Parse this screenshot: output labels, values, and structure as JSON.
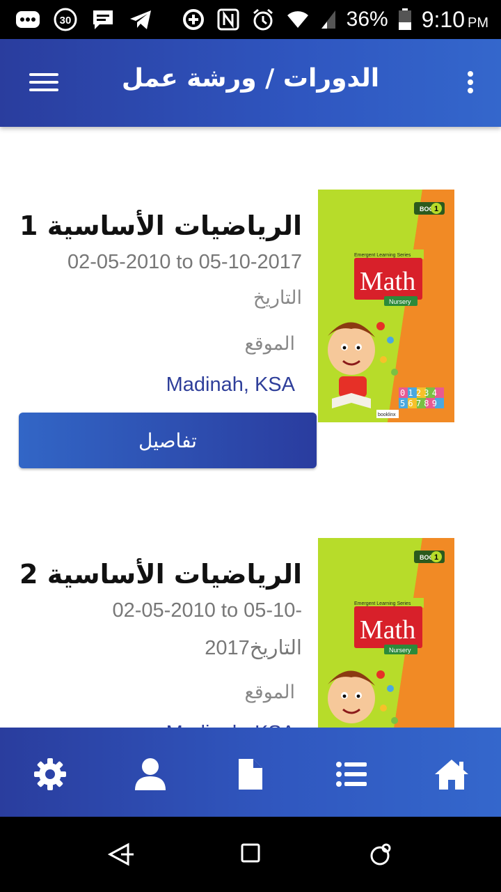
{
  "status_bar": {
    "notification_count": "30",
    "battery": "36%",
    "time": "9:10",
    "ampm": "PM"
  },
  "app_bar": {
    "title": "الدورات / ورشة عمل"
  },
  "courses": [
    {
      "title": "الرياضيات الأساسية 1",
      "dates": "02-05-2010 to 05-10-2017",
      "date_label": "التاريخ",
      "location_label": "الموقع",
      "location": "Madinah, KSA",
      "details_label": "تفاصيل",
      "cover": {
        "book_label": "BOOK",
        "book_number": "1",
        "series": "Emergent Learning Series",
        "subject": "Math",
        "level": "Nursery",
        "digits_top": "01234",
        "digits_bottom": "56789",
        "publisher": "booklinx"
      }
    },
    {
      "title": "الرياضيات الأساسية 2",
      "dates_line1": "02-05-2010 to 05-10-",
      "dates_line2": "التاريخ2017",
      "location_label": "الموقع",
      "location": "Madinah, KSA",
      "cover": {
        "book_label": "BOOK",
        "book_number": "1",
        "series": "Emergent Learning Series",
        "subject": "Math",
        "level": "Nursery"
      }
    }
  ],
  "bottom_nav": [
    "settings-icon",
    "profile-icon",
    "document-icon",
    "list-icon",
    "home-icon"
  ],
  "android_nav": [
    "back-icon",
    "recents-icon",
    "home-circle-icon"
  ],
  "colors": {
    "primary_dark": "#2a3d9e",
    "primary_light": "#3467cc",
    "location_text": "#2f3f9a"
  }
}
